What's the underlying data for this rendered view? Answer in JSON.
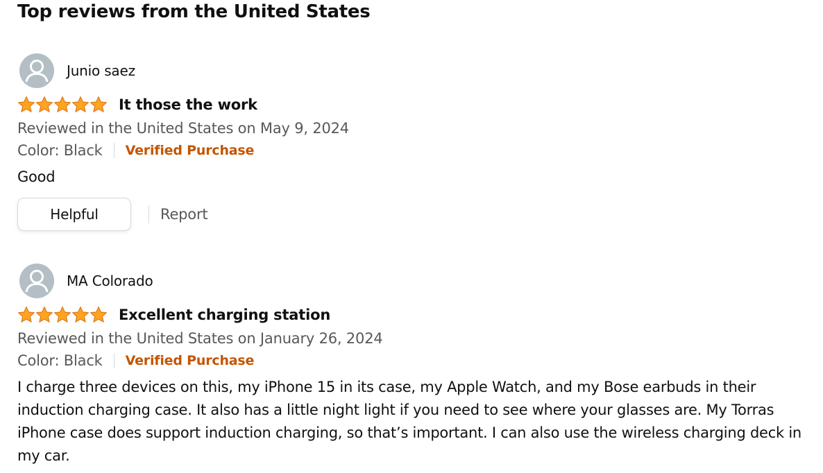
{
  "section": {
    "title": "Top reviews from the United States"
  },
  "reviews": [
    {
      "reviewer": "Junio saez",
      "rating": 5,
      "title": "It those the work",
      "date_line": "Reviewed in the United States on May 9, 2024",
      "variant": "Color: Black",
      "verified": "Verified Purchase",
      "body": "Good",
      "helpful_label": "Helpful",
      "report_label": "Report"
    },
    {
      "reviewer": "MA Colorado",
      "rating": 5,
      "title": "Excellent charging station",
      "date_line": "Reviewed in the United States on January 26, 2024",
      "variant": "Color: Black",
      "verified": "Verified Purchase",
      "body": "I charge three devices on this, my iPhone 15 in its case, my Apple Watch, and my Bose earbuds in their induction charging case. It also has a little night light if you need to see where your glasses are. My Torras iPhone case does support induction charging, so that’s important. I can also use the wireless charging deck in my car."
    }
  ],
  "colors": {
    "star": "#ffa41c",
    "star_outline": "#de7921",
    "verified": "#c45500",
    "secondary_text": "#565959",
    "avatar_bg": "#b3bfc4"
  },
  "icons": {
    "avatar": "user-silhouette-icon",
    "star": "star-filled-icon"
  }
}
